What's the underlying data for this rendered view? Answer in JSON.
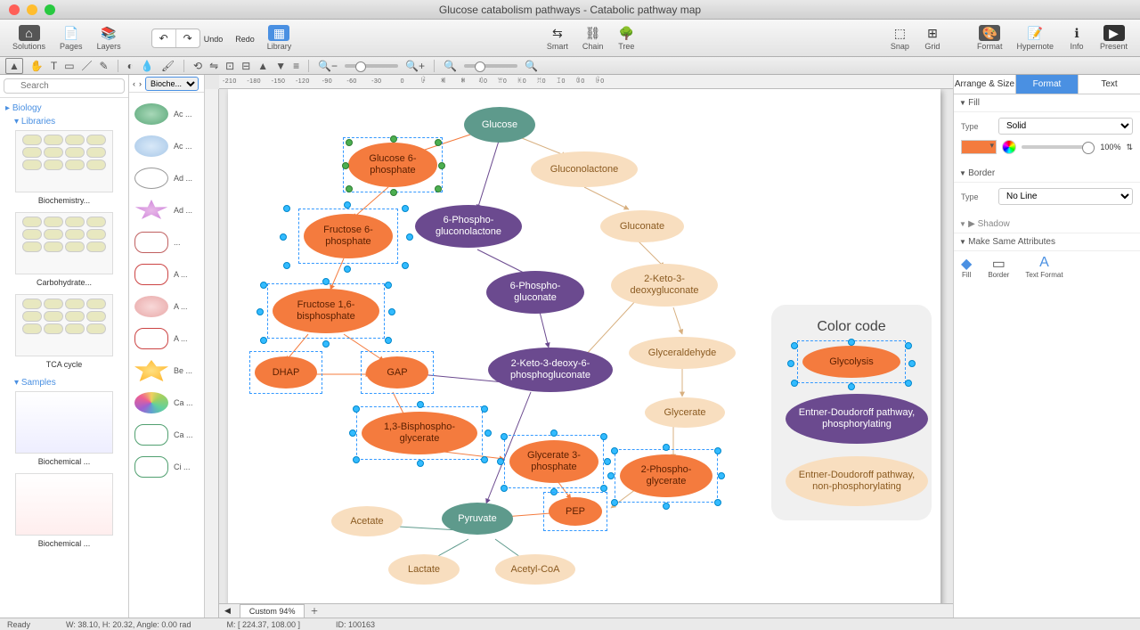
{
  "window_title": "Glucose catabolism pathways - Catabolic pathway map",
  "toolbar": {
    "solutions": "Solutions",
    "pages": "Pages",
    "layers": "Layers",
    "undo": "Undo",
    "redo": "Redo",
    "library": "Library",
    "smart": "Smart",
    "chain": "Chain",
    "tree": "Tree",
    "snap": "Snap",
    "grid": "Grid",
    "format": "Format",
    "hypernote": "Hypernote",
    "info": "Info",
    "present": "Present"
  },
  "search_placeholder": "Search",
  "tree": {
    "root": "Biology",
    "libraries": "Libraries",
    "samples": "Samples",
    "items": [
      "Biochemistry...",
      "Carbohydrate...",
      "TCA cycle",
      "Biochemical ...",
      "Biochemical ..."
    ]
  },
  "palette": {
    "title": "Bioche...",
    "labels": [
      "Ac ...",
      "Ac ...",
      "Ad ...",
      "Ad ...",
      "...",
      "A ...",
      "A ...",
      "A ...",
      "Be ...",
      "Ca ...",
      "Ca ...",
      "Ci ..."
    ]
  },
  "legend": {
    "title": "Color code",
    "items": [
      "Glycolysis",
      "Entner-Doudoroff pathway, phosphorylating",
      "Entner-Doudoroff pathway, non-phosphorylating"
    ]
  },
  "nodes": {
    "glucose": "Glucose",
    "g6p": "Glucose 6-phosphate",
    "f6p": "Fructose 6-phosphate",
    "f16bp": "Fructose 1,6-bisphosphate",
    "dhap": "DHAP",
    "gap": "GAP",
    "bpg": "1,3-Bisphospho-glycerate",
    "g3p": "Glycerate 3-phosphate",
    "pep": "PEP",
    "pyruvate": "Pyruvate",
    "acetate": "Acetate",
    "lactate": "Lactate",
    "acoa": "Acetyl-CoA",
    "pgl": "6-Phospho-gluconolactone",
    "pg": "6-Phospho-gluconate",
    "kdpg": "2-Keto-3-deoxy-6-phosphogluconate",
    "gluconolactone": "Gluconolactone",
    "gluconate": "Gluconate",
    "kdg": "2-Keto-3-deoxygluconate",
    "glyceraldehyde": "Glyceraldehyde",
    "glycerate": "Glycerate",
    "pg2": "2-Phospho-glycerate"
  },
  "inspector": {
    "tabs": [
      "Arrange & Size",
      "Format",
      "Text"
    ],
    "fill_sect": "Fill",
    "type_lbl": "Type",
    "solid": "Solid",
    "pct": "100%",
    "border_sect": "Border",
    "noline": "No Line",
    "shadow_sect": "Shadow",
    "msa": "Make Same Attributes",
    "msa_items": [
      "Fill",
      "Border",
      "Text Format"
    ]
  },
  "tabs_bottom": "Custom 94%",
  "status": {
    "ready": "Ready",
    "dims": "W: 38.10,  H: 20.32,  Angle: 0.00 rad",
    "mouse": "M: [ 224.37, 108.00 ]",
    "id": "ID: 100163"
  }
}
